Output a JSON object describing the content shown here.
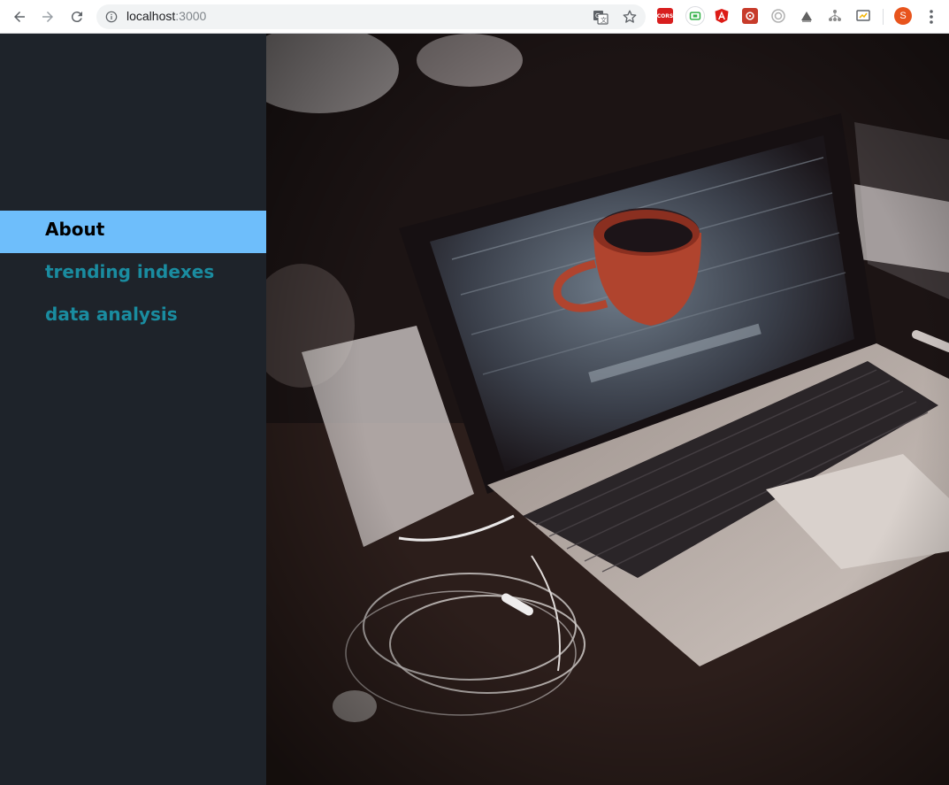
{
  "browser": {
    "url_host": "localhost",
    "url_port": ":3000",
    "profile_initial": "S",
    "extensions": [
      {
        "name": "cors-icon",
        "label": "CORS",
        "color": "#d81e1e"
      },
      {
        "name": "tab-extension-icon",
        "label": "",
        "color": "#35b24a"
      },
      {
        "name": "angular-icon",
        "label": "",
        "color": "#dd1b16"
      },
      {
        "name": "red-extension-icon",
        "label": "",
        "color": "#c73b2a"
      },
      {
        "name": "lighthouse-icon",
        "label": "",
        "color": "#9e9e9e"
      },
      {
        "name": "gray-extension-icon",
        "label": "",
        "color": "#616161"
      },
      {
        "name": "tree-extension-icon",
        "label": "",
        "color": "#8a8a8a"
      },
      {
        "name": "cast-extension-icon",
        "label": "",
        "color": "#5f6368"
      }
    ]
  },
  "sidebar": {
    "items": [
      {
        "label": "About",
        "active": true
      },
      {
        "label": "trending indexes",
        "active": false
      },
      {
        "label": "data analysis",
        "active": false
      }
    ]
  },
  "hero": {
    "image": "laptop-with-coffee-cup-photo"
  }
}
